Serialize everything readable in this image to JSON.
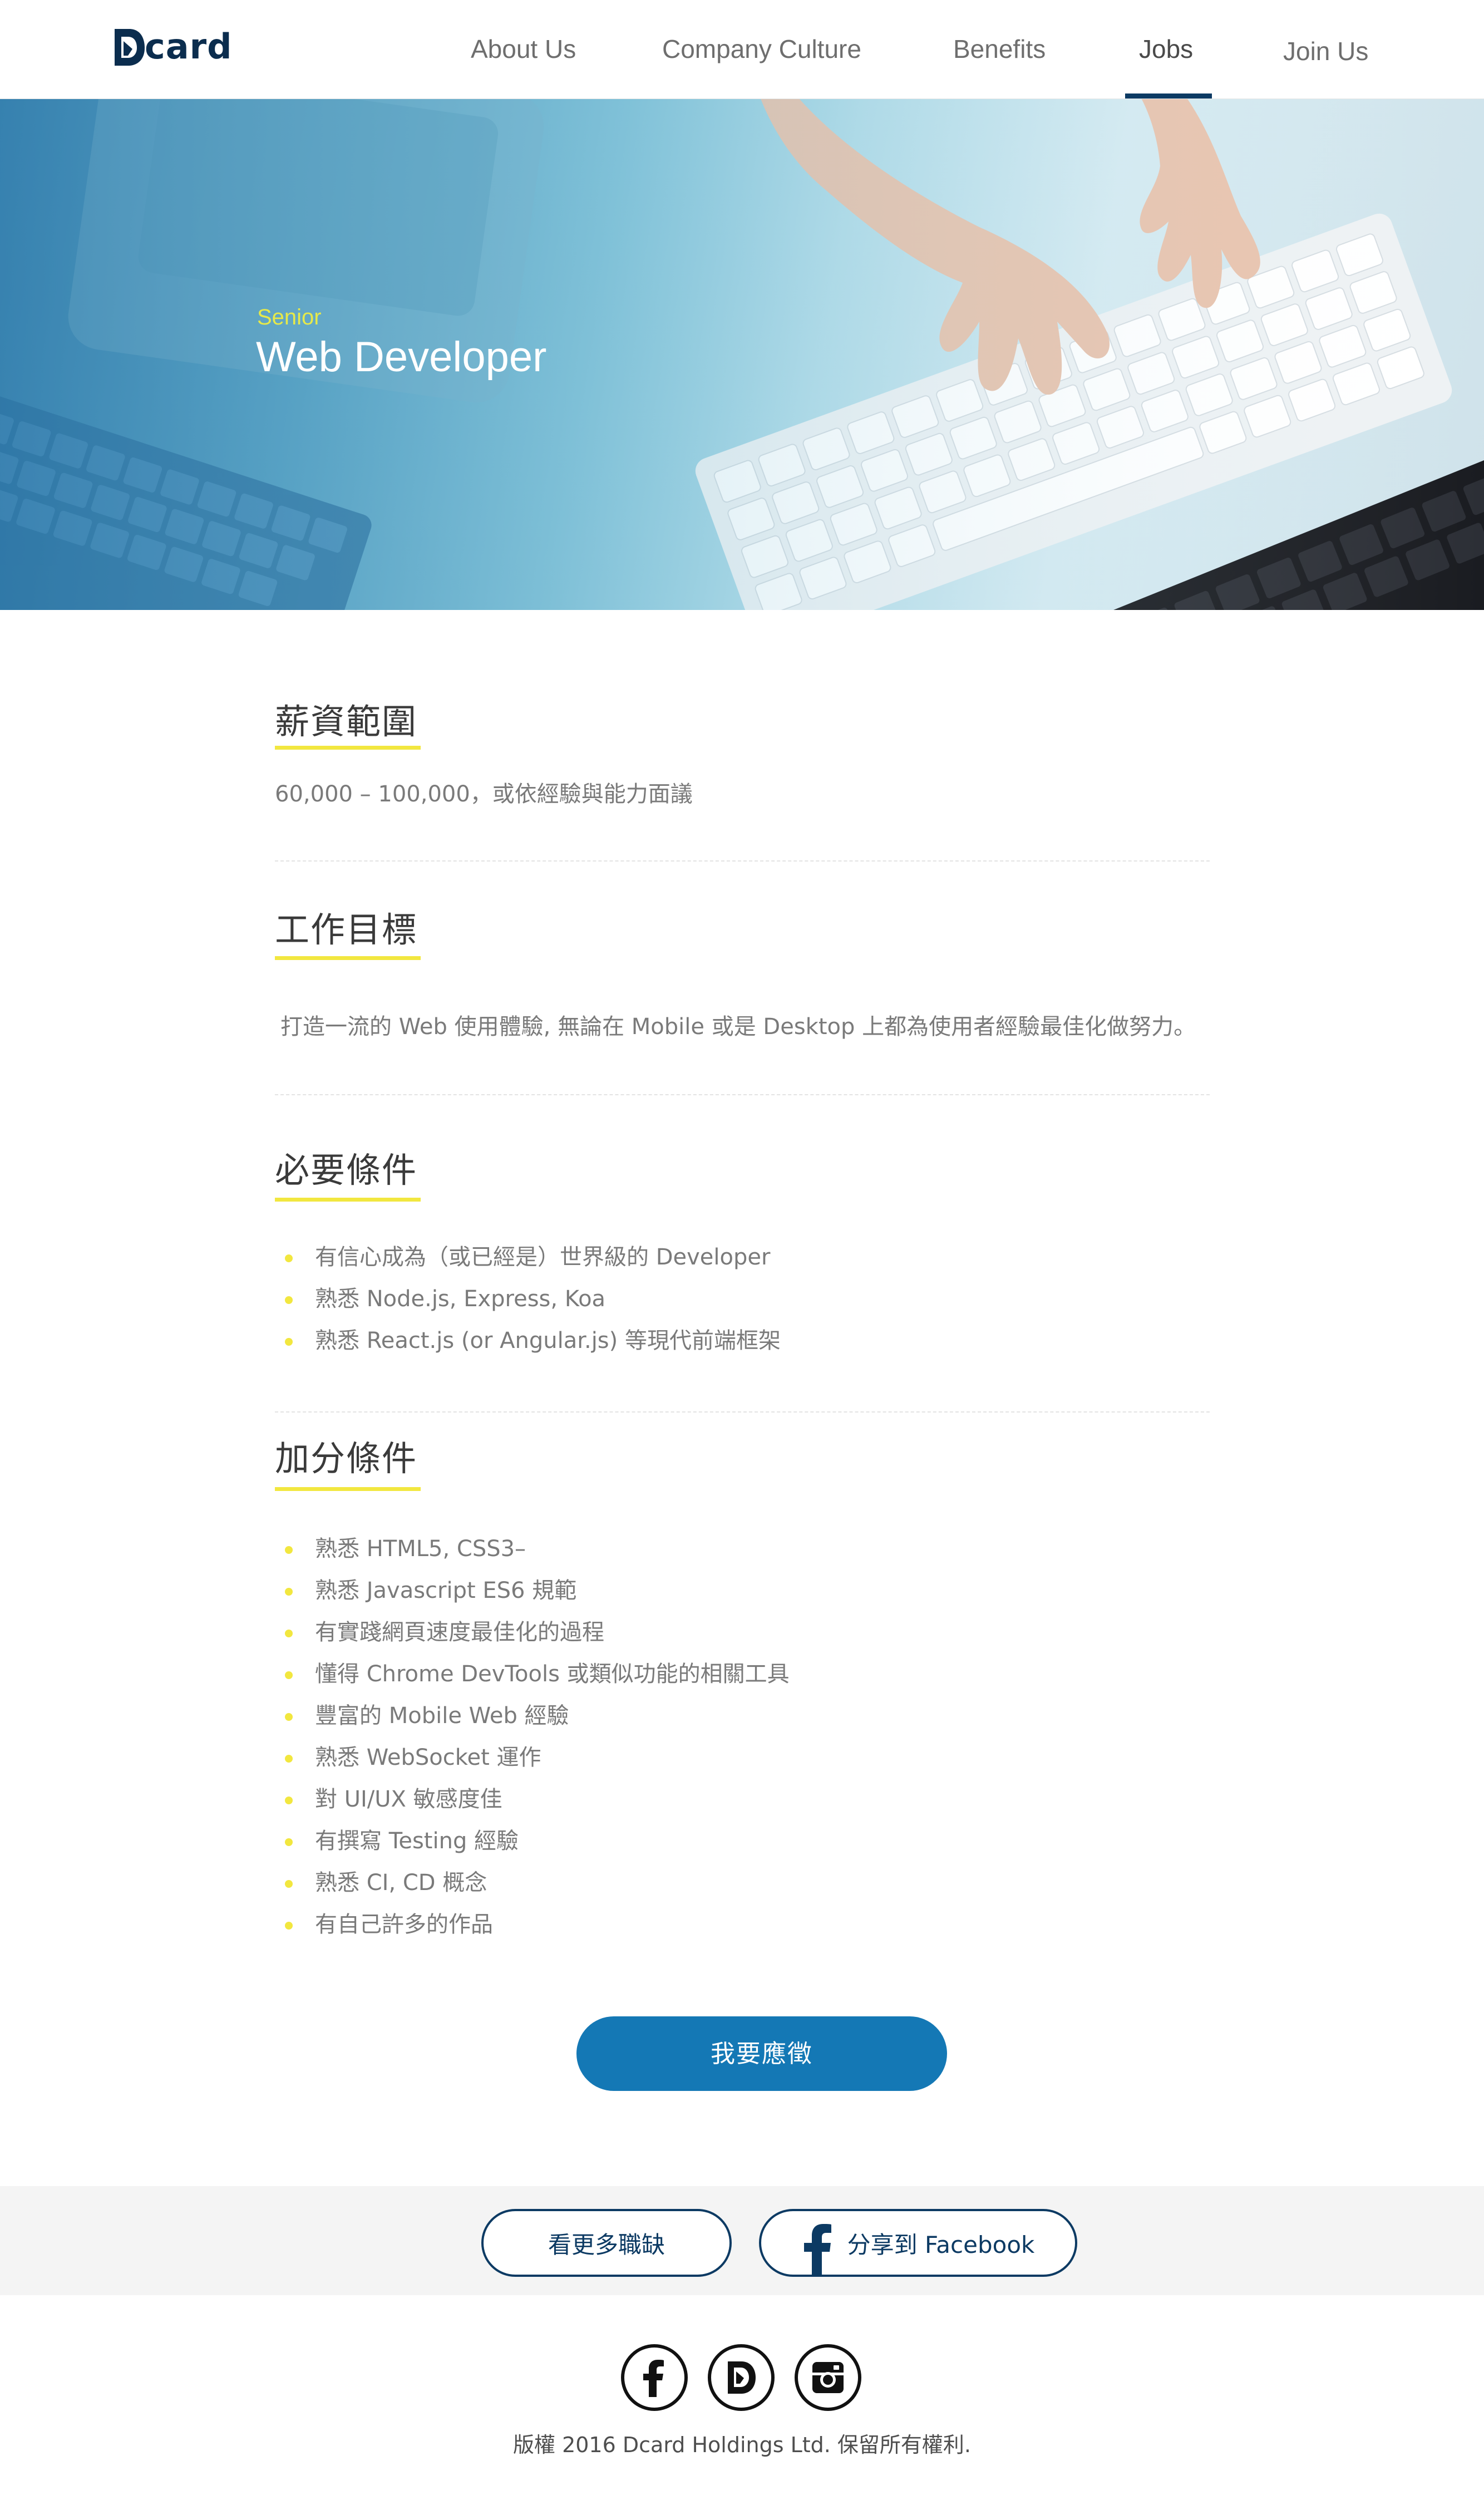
{
  "header": {
    "logo_text": "card",
    "nav": [
      "About Us",
      "Company Culture",
      "Benefits",
      "Jobs",
      "Join Us"
    ],
    "active_nav": "Jobs"
  },
  "hero": {
    "subtitle": "Senior",
    "title": "Web Developer"
  },
  "sections": {
    "salary": {
      "title": "薪資範圍",
      "text": "60,000 – 100,000，或依經驗與能力面議"
    },
    "goal": {
      "title": "工作目標",
      "text": "打造一流的 Web 使用體驗, 無論在 Mobile 或是 Desktop 上都為使用者經驗最佳化做努力。"
    },
    "required": {
      "title": "必要條件",
      "items": [
        "有信心成為（或已經是）世界級的 Developer",
        "熟悉 Node.js, Express, Koa",
        "熟悉 React.js (or Angular.js) 等現代前端框架"
      ]
    },
    "bonus": {
      "title": "加分條件",
      "items": [
        "熟悉 HTML5, CSS3–",
        "熟悉 Javascript ES6 規範",
        "有實踐網頁速度最佳化的過程",
        "懂得 Chrome DevTools 或類似功能的相關工具",
        "豐富的 Mobile Web 經驗",
        "熟悉 WebSocket 運作",
        "對 UI/UX 敏感度佳",
        "有撰寫 Testing 經驗",
        "熟悉 CI, CD 概念",
        "有自己許多的作品"
      ]
    }
  },
  "apply_label": "我要應徵",
  "footer": {
    "more_jobs_label": "看更多職缺",
    "share_label": "分享到 Facebook",
    "social_icons": [
      "facebook-icon",
      "dcard-icon",
      "instagram-icon"
    ],
    "copyright": "版權 2016 Dcard Holdings Ltd. 保留所有權利."
  },
  "colors": {
    "brand_navy": "#0c3a63",
    "accent_yellow": "#f2e73f",
    "button_blue": "#1478b5"
  }
}
